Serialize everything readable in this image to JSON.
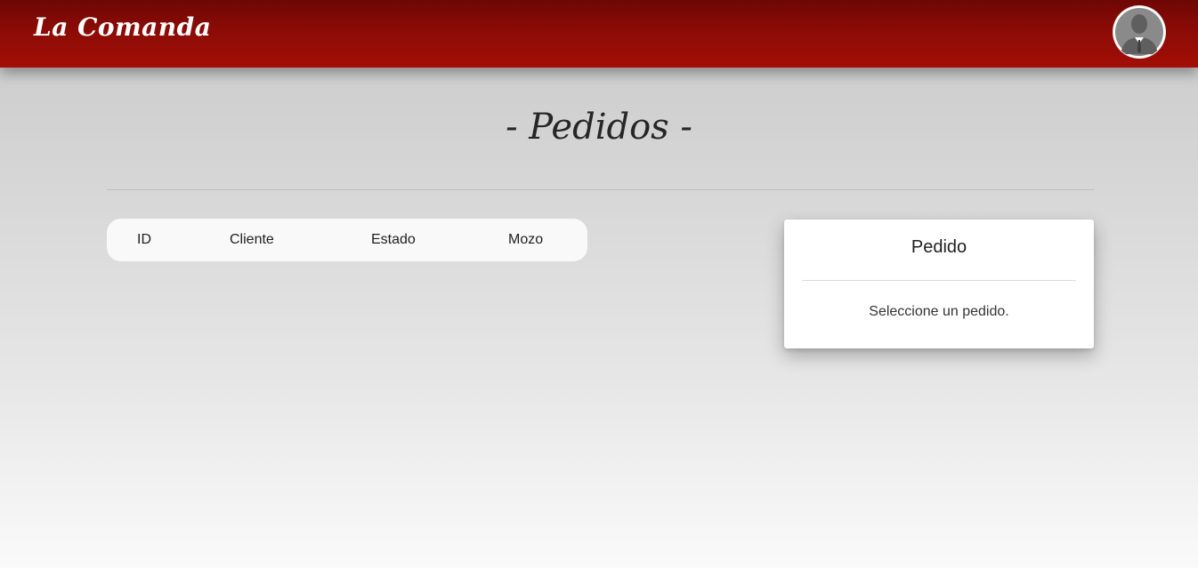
{
  "app": {
    "brand": "La Comanda"
  },
  "header": {
    "avatar_icon": "user-avatar-icon"
  },
  "page": {
    "title": "- Pedidos -"
  },
  "orders_table": {
    "columns": [
      "ID",
      "Cliente",
      "Estado",
      "Mozo"
    ],
    "rows": []
  },
  "detail_card": {
    "title": "Pedido",
    "message": "Seleccione un pedido."
  },
  "colors": {
    "brand_red": "#9a0d07",
    "brand_red_dark": "#6e0704",
    "background": "#d6d6d6",
    "card": "#ffffff"
  }
}
